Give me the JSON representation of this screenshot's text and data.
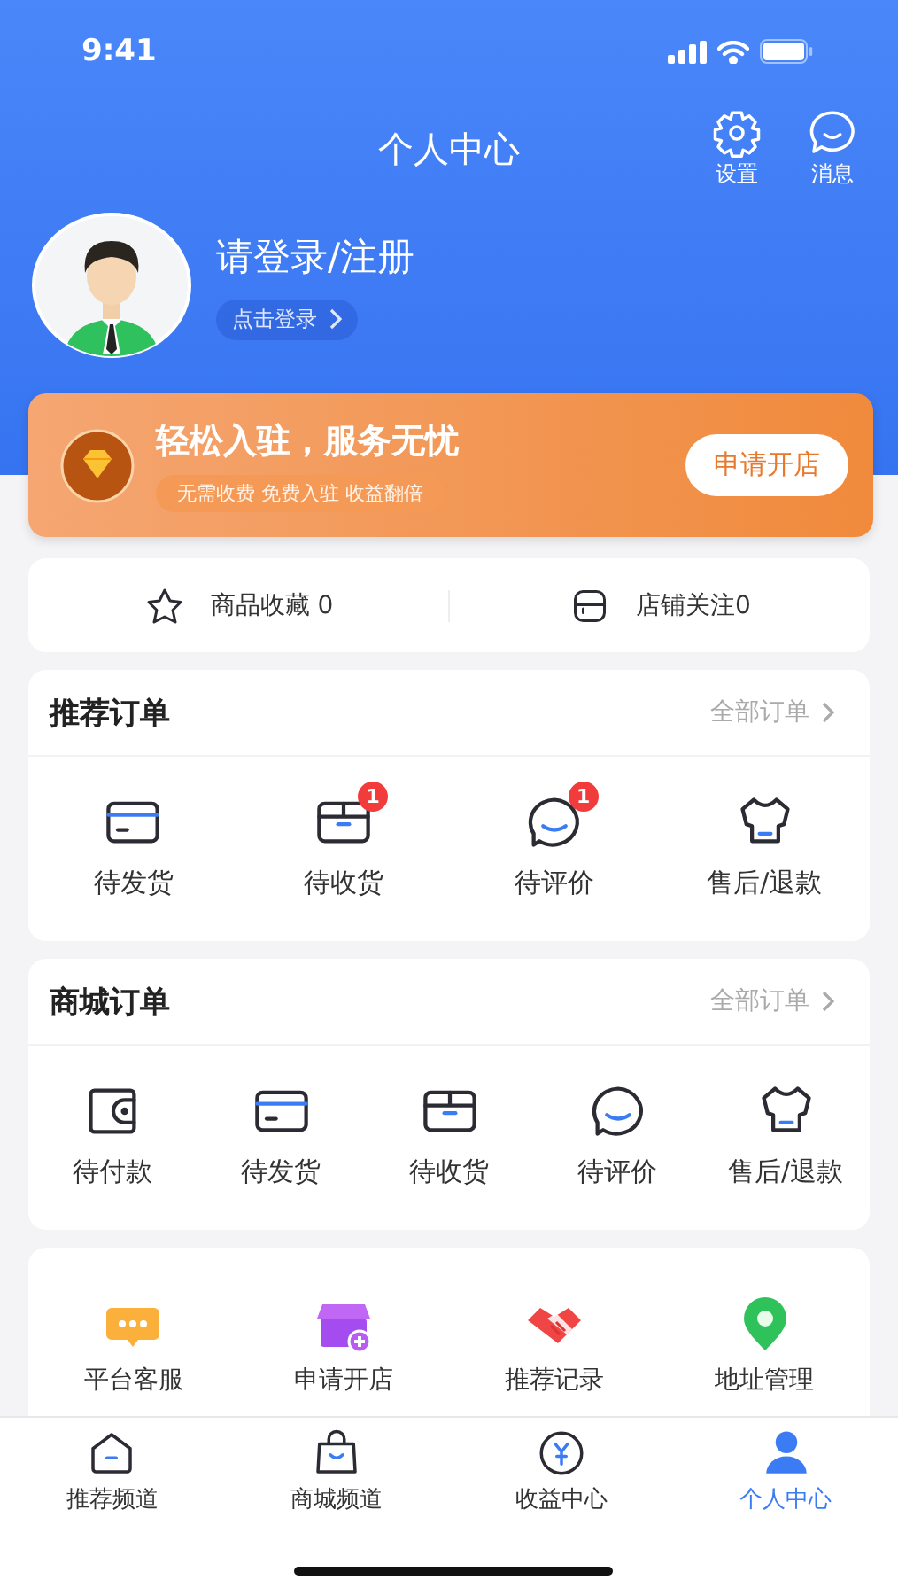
{
  "status_bar": {
    "time": "9:41"
  },
  "header": {
    "title": "个人中心",
    "actions": [
      {
        "kind": "settings",
        "label": "设置"
      },
      {
        "kind": "message",
        "label": "消息"
      }
    ]
  },
  "profile": {
    "name": "请登录/注册",
    "login_link": "点击登录"
  },
  "banner": {
    "title": "轻松入驻，服务无忧",
    "subtitle": "无需收费 免费入驻 收益翻倍",
    "button": "申请开店"
  },
  "favorites": [
    {
      "kind": "star",
      "label": "商品收藏 0"
    },
    {
      "kind": "shop",
      "label": "店铺关注0"
    }
  ],
  "order_sections": [
    {
      "title": "推荐订单",
      "link": "全部订单",
      "items": [
        {
          "kind": "card",
          "label": "待发货"
        },
        {
          "kind": "box",
          "label": "待收货",
          "badge": "1"
        },
        {
          "kind": "chat",
          "label": "待评价",
          "badge": "1"
        },
        {
          "kind": "shirt",
          "label": "售后/退款"
        }
      ]
    },
    {
      "title": "商城订单",
      "link": "全部订单",
      "items": [
        {
          "kind": "wallet",
          "label": "待付款"
        },
        {
          "kind": "card",
          "label": "待发货"
        },
        {
          "kind": "box",
          "label": "待收货"
        },
        {
          "kind": "chat",
          "label": "待评价"
        },
        {
          "kind": "shirt",
          "label": "售后/退款"
        }
      ]
    }
  ],
  "services": [
    {
      "kind": "support",
      "label": "平台客服"
    },
    {
      "kind": "store",
      "label": "申请开店"
    },
    {
      "kind": "handshake",
      "label": "推荐记录"
    },
    {
      "kind": "location",
      "label": "地址管理"
    }
  ],
  "tab_bar": [
    {
      "kind": "home",
      "label": "推荐频道",
      "selected": false
    },
    {
      "kind": "bag",
      "label": "商城频道",
      "selected": false
    },
    {
      "kind": "coin",
      "label": "收益中心",
      "selected": false
    },
    {
      "kind": "person",
      "label": "个人中心",
      "selected": true
    }
  ]
}
